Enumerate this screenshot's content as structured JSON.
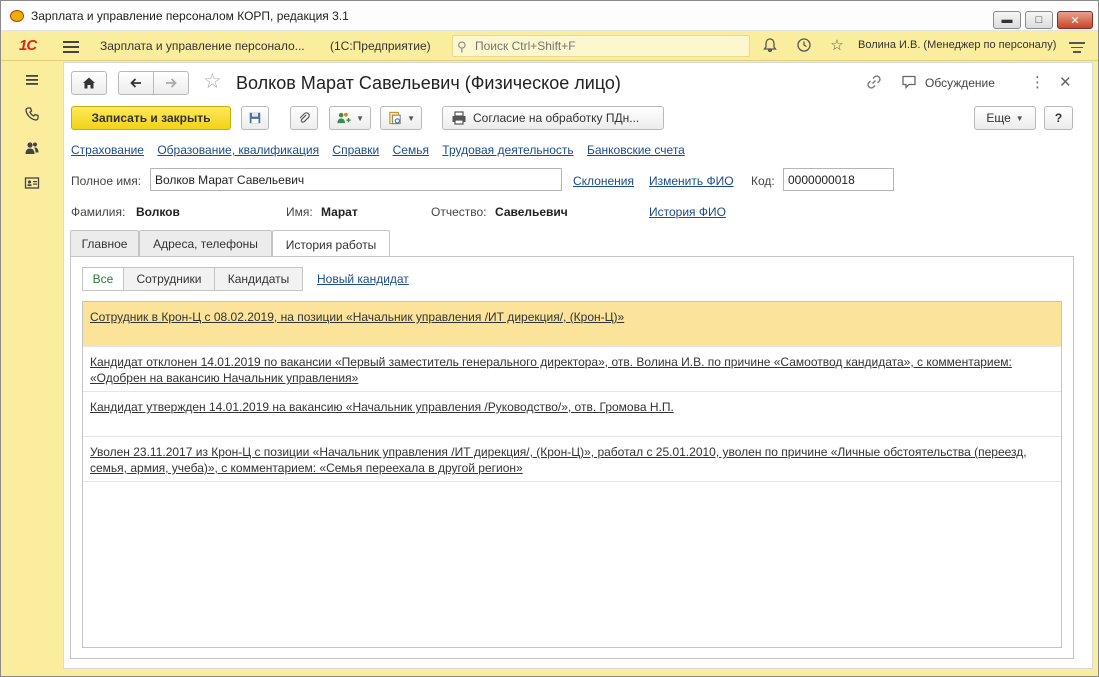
{
  "window": {
    "title": "Зарплата и управление персоналом КОРП, редакция 3.1",
    "minimize": "▬",
    "maximize": "□",
    "close": "✕"
  },
  "appbar": {
    "logo": "1С",
    "title": "Зарплата и управление персонало...",
    "platform": "(1С:Предприятие)",
    "search_placeholder": "Поиск Ctrl+Shift+F",
    "user": "Волина И.В. (Менеджер по персоналу)"
  },
  "form": {
    "title": "Волков Марат Савельевич (Физическое лицо)",
    "discussion": "Обсуждение",
    "toolbar": {
      "save_close": "Записать и закрыть",
      "consent": "Согласие на обработку ПДн...",
      "more": "Еще",
      "help": "?"
    },
    "links": [
      "Страхование",
      "Образование, квалификация",
      "Справки",
      "Семья",
      "Трудовая деятельность",
      "Банковские счета"
    ],
    "full_name_label": "Полное имя:",
    "full_name_value": "Волков Марат Савельевич",
    "declensions": "Склонения",
    "change_fio": "Изменить ФИО",
    "code_label": "Код:",
    "code_value": "0000000018",
    "surname_label": "Фамилия:",
    "surname": "Волков",
    "name_label": "Имя:",
    "name": "Марат",
    "patronymic_label": "Отчество:",
    "patronymic": "Савельевич",
    "fio_history": "История ФИО",
    "tabs": [
      "Главное",
      "Адреса, телефоны",
      "История работы"
    ],
    "filters": [
      "Все",
      "Сотрудники",
      "Кандидаты"
    ],
    "new_candidate": "Новый кандидат",
    "history": [
      "Сотрудник в Крон-Ц с 08.02.2019, на позиции «Начальник управления /ИТ дирекция/, (Крон-Ц)»",
      "Кандидат отклонен 14.01.2019 по вакансии «Первый заместитель генерального директора», отв. Волина И.В. по причине «Самоотвод кандидата», с комментарием: «Одобрен на вакансию Начальник управления»",
      "Кандидат утвержден 14.01.2019 на вакансию «Начальник управления /Руководство/», отв. Громова Н.П.",
      "Уволен 23.11.2017 из Крон-Ц с позиции «Начальник управления /ИТ дирекция/, (Крон-Ц)», работал с 25.01.2010, уволен по причине «Личные обстоятельства (переезд, семья, армия, учеба)», с комментарием: «Семья переехала в другой регион»"
    ]
  },
  "colors": {
    "panel_yellow": "#fbed9e",
    "save_button": "#f3d218",
    "highlight_row": "#fbe49a",
    "link": "#1a4c8c"
  }
}
